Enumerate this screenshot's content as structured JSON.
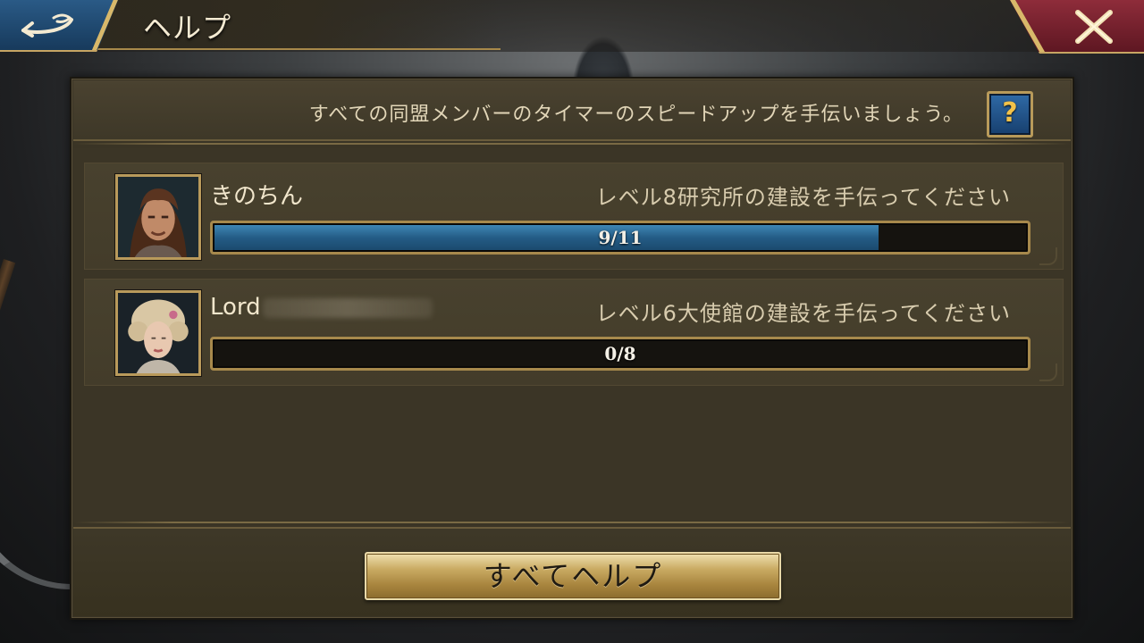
{
  "header": {
    "title": "ヘルプ",
    "back_icon": "back-arrow-icon",
    "close_icon": "close-x-icon"
  },
  "panel": {
    "instruction": "すべての同盟メンバーのタイマーのスピードアップを手伝いましょう。",
    "help_button_label": "?"
  },
  "requests": [
    {
      "player_name": "きのちん",
      "request": "レベル8研究所の建設を手伝ってください",
      "progress_text": "9/11",
      "progress_current": 9,
      "progress_total": 11
    },
    {
      "player_name": "Lord",
      "request": "レベル6大使館の建設を手伝ってください",
      "progress_text": "0/8",
      "progress_current": 0,
      "progress_total": 8
    }
  ],
  "footer": {
    "help_all_label": "すべてヘルプ"
  },
  "colors": {
    "progress_fill": "#245c86",
    "button_gold": "#c9aa62",
    "close_red": "#8e2c3a",
    "back_blue": "#2a5a86"
  }
}
